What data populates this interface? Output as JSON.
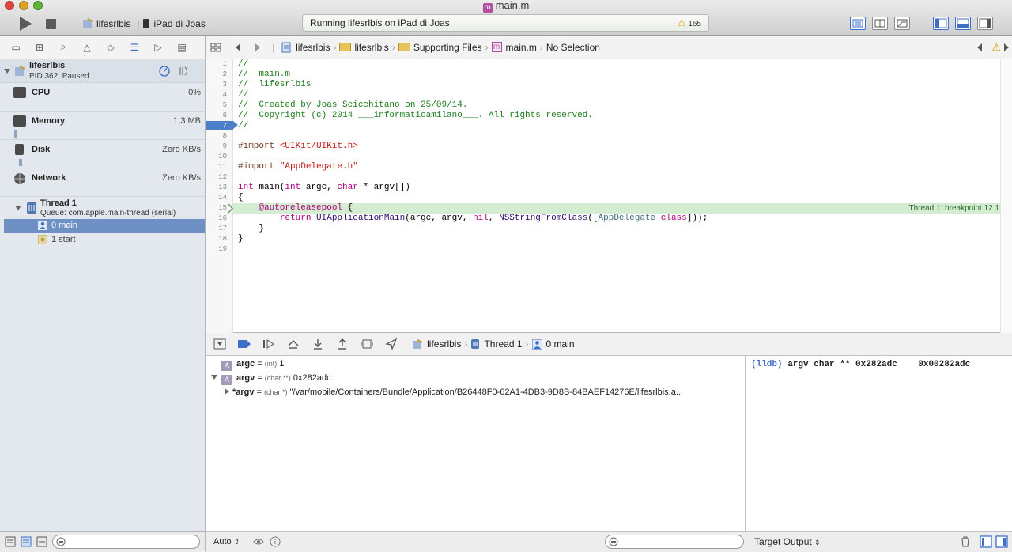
{
  "window": {
    "title": "main.m",
    "file_badge": "m"
  },
  "toolbar": {
    "scheme": "lifesrlbis",
    "device": "iPad di Joas",
    "status": "Running lifesrlbis on iPad di Joas",
    "warning_count": "165"
  },
  "process": {
    "name": "lifesrlbis",
    "detail": "PID 362, Paused"
  },
  "gauges": [
    {
      "name": "CPU",
      "value": "0%"
    },
    {
      "name": "Memory",
      "value": "1,3 MB"
    },
    {
      "name": "Disk",
      "value": "Zero KB/s"
    },
    {
      "name": "Network",
      "value": "Zero KB/s"
    }
  ],
  "thread": {
    "name": "Thread 1",
    "queue": "Queue: com.apple.main-thread (serial)"
  },
  "frames": [
    "0 main",
    "1 start"
  ],
  "jumpbar": {
    "project": "lifesrlbis",
    "group": "lifesrlbis",
    "subgroup": "Supporting Files",
    "file": "main.m",
    "selection": "No Selection"
  },
  "editor": {
    "line_numbers": [
      "1",
      "2",
      "3",
      "4",
      "5",
      "6",
      "7",
      "8",
      "9",
      "10",
      "11",
      "12",
      "13",
      "14",
      "15",
      "16",
      "17",
      "18",
      "19"
    ],
    "breakpoint_line": "7",
    "breakpoint_label": "Thread 1: breakpoint 12.1",
    "code": {
      "l1": "//",
      "l2": "//  main.m",
      "l3": "//  lifesrlbis",
      "l4": "//",
      "l5": "//  Created by Joas Scicchitano on 25/09/14.",
      "l6": "//  Copyright (c) 2014 ___informaticamilano___. All rights reserved.",
      "l7": "//",
      "l9_kw": "#import",
      "l9_str": "<UIKit/UIKit.h>",
      "l11_kw": "#import",
      "l11_str": "\"AppDelegate.h\"",
      "l13_int": "int",
      "l13_a": " main(",
      "l13_int2": "int",
      "l13_b": " argc, ",
      "l13_char": "char",
      "l13_c": " * argv[])",
      "l14": "{",
      "l15_kw": "@autoreleasepool",
      "l15_rest": " {",
      "l16_ret": "return",
      "l16_fn": "UIApplicationMain",
      "l16_a": "(argc, argv, ",
      "l16_nil": "nil",
      "l16_b": ", ",
      "l16_fn2": "NSStringFromClass",
      "l16_c": "([",
      "l16_cls": "AppDelegate",
      "l16_sp": " ",
      "l16_class": "class",
      "l16_d": "]));",
      "l17": "    }",
      "l18": "}"
    }
  },
  "debugbar": {
    "project": "lifesrlbis",
    "thread": "Thread 1",
    "frame": "0 main"
  },
  "variables": [
    {
      "badge": "A",
      "name": "argc",
      "eq": " = ",
      "type": "(int)",
      "value": " 1"
    },
    {
      "badge": "A",
      "name": "argv",
      "eq": " = ",
      "type": "(char **)",
      "value": " 0x282adc"
    },
    {
      "name": "*argv",
      "eq": " = ",
      "type": "(char *)",
      "value": " \"/var/mobile/Containers/Bundle/Application/B26448F0-62A1-4DB3-9D8B-84BAEF14276E/lifesrlbis.a..."
    }
  ],
  "console": {
    "prompt": "(lldb)",
    "command": " argv char ** 0x282adc",
    "result": "    0x00282adc"
  },
  "footer": {
    "auto_label": "Auto",
    "target_output": "Target Output"
  },
  "colors": {
    "breakpoint": "#4d7ec8",
    "pc_highlight": "#d4ecd1",
    "comment": "#1e7d1c",
    "keyword": "#b3007f",
    "string": "#c41a16"
  }
}
